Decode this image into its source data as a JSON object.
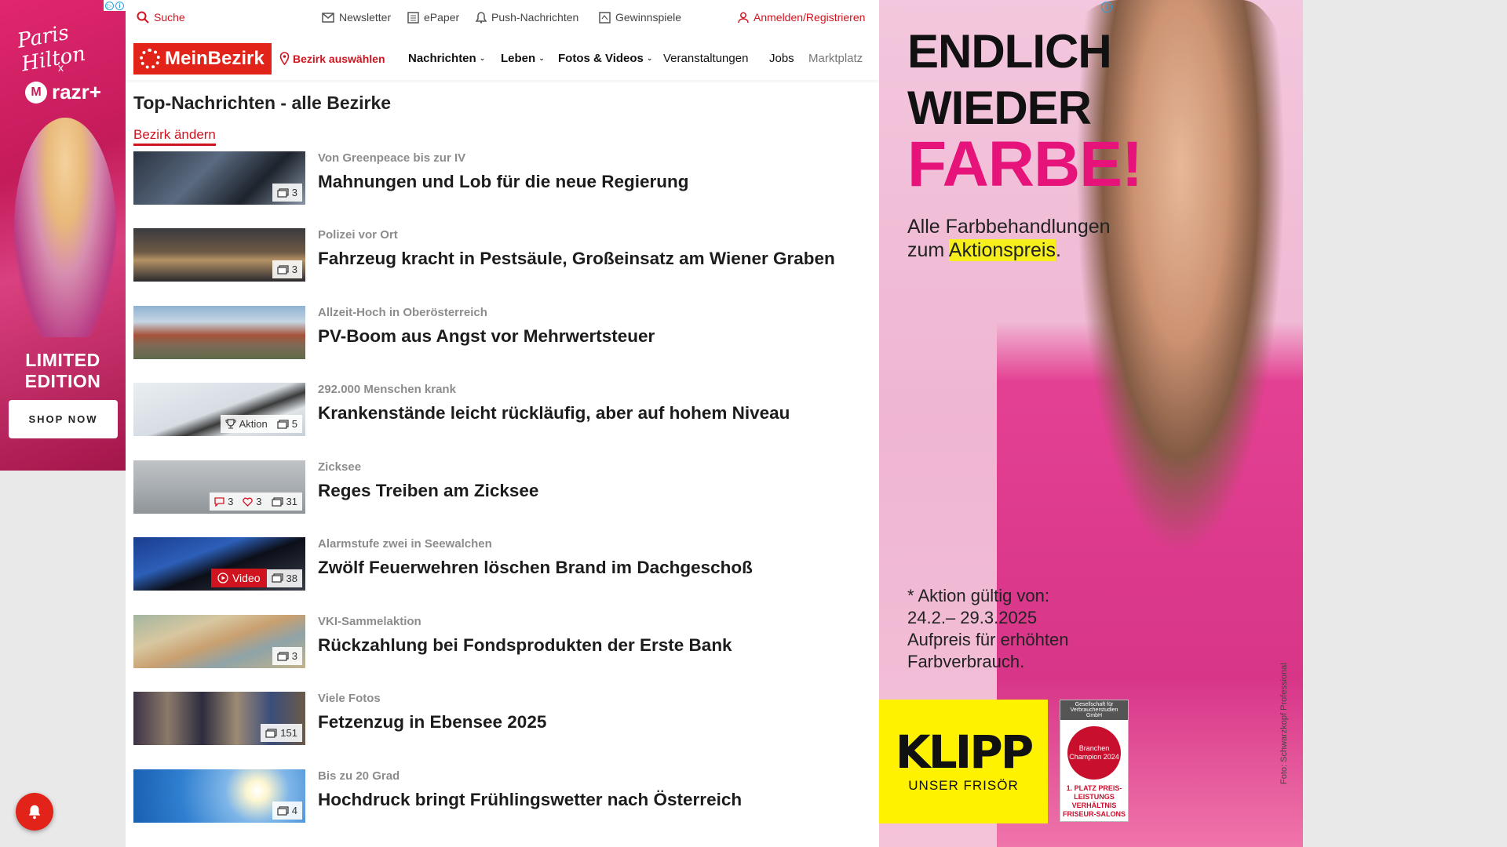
{
  "left_ad": {
    "brand1": "Paris Hilton",
    "cross": "x",
    "brand2": "razr+",
    "headline_line1": "LIMITED",
    "headline_line2": "EDITION",
    "cta": "SHOP NOW"
  },
  "topbar": {
    "search": "Suche",
    "newsletter": "Newsletter",
    "epaper": "ePaper",
    "push": "Push-Nachrichten",
    "games": "Gewinnspiele",
    "login": "Anmelden/Registrieren"
  },
  "nav": {
    "logo": "MeinBezirk",
    "district": "Bezirk auswählen",
    "items": [
      "Nachrichten",
      "Leben",
      "Fotos & Videos",
      "Veranstaltungen",
      "Jobs",
      "Marktplatz"
    ]
  },
  "page": {
    "heading": "Top-Nachrichten - alle Bezirke",
    "change_district": "Bezirk ändern"
  },
  "articles": [
    {
      "kicker": "Von Greenpeace bis zur IV",
      "title": "Mahnungen und Lob für die neue Regierung",
      "photos": "3"
    },
    {
      "kicker": "Polizei vor Ort",
      "title": "Fahrzeug kracht in Pestsäule, Großeinsatz am Wiener Graben",
      "photos": "3"
    },
    {
      "kicker": "Allzeit-Hoch in Oberösterreich",
      "title": "PV-Boom aus Angst vor Mehrwertsteuer",
      "photos": ""
    },
    {
      "kicker": "292.000 Menschen krank",
      "title": "Krankenstände leicht rückläufig, aber auf hohem Niveau",
      "aktion": "Aktion",
      "photos": "5"
    },
    {
      "kicker": "Zicksee",
      "title": "Reges Treiben am Zicksee",
      "comments": "3",
      "likes": "3",
      "photos": "31"
    },
    {
      "kicker": "Alarmstufe zwei in Seewalchen",
      "title": "Zwölf Feuerwehren löschen Brand im Dachgeschoß",
      "video": "Video",
      "photos": "38"
    },
    {
      "kicker": "VKI-Sammelaktion",
      "title": "Rückzahlung bei Fondsprodukten der Erste Bank",
      "photos": "3"
    },
    {
      "kicker": "Viele Fotos",
      "title": "Fetzenzug in Ebensee 2025",
      "photos": "151"
    },
    {
      "kicker": "Bis zu 20 Grad",
      "title": "Hochdruck bringt Frühlingswetter nach Österreich",
      "photos": "4"
    }
  ],
  "right_ad": {
    "line1": "ENDLICH",
    "line2": "WIEDER",
    "line3": "FARBE!",
    "sub1": "Alle Farbbehandlungen",
    "sub2_pre": "zum ",
    "sub2_hl": "Aktionspreis",
    "sub2_post": ".",
    "terms1": "* Aktion gültig von:",
    "terms2": "24.2.– 29.3.2025",
    "terms3": "Aufpreis für erhöhten",
    "terms4": "Farbverbrauch.",
    "brand": "KLIPP",
    "brand_sub": "UNSER FRISÖR",
    "award_top": "Gesellschaft für Verbraucherstudien GmbH",
    "award_circle": "Branchen Champion 2024",
    "award_place": "1. PLATZ PREIS-LEISTUNGS VERHÄLTNIS FRISEUR-SALONS",
    "credit": "Foto: Schwarzkopf Professional"
  },
  "colors": {
    "brand_red": "#e2231a",
    "link_red": "#d0141f",
    "ad_pink": "#e5137a"
  }
}
